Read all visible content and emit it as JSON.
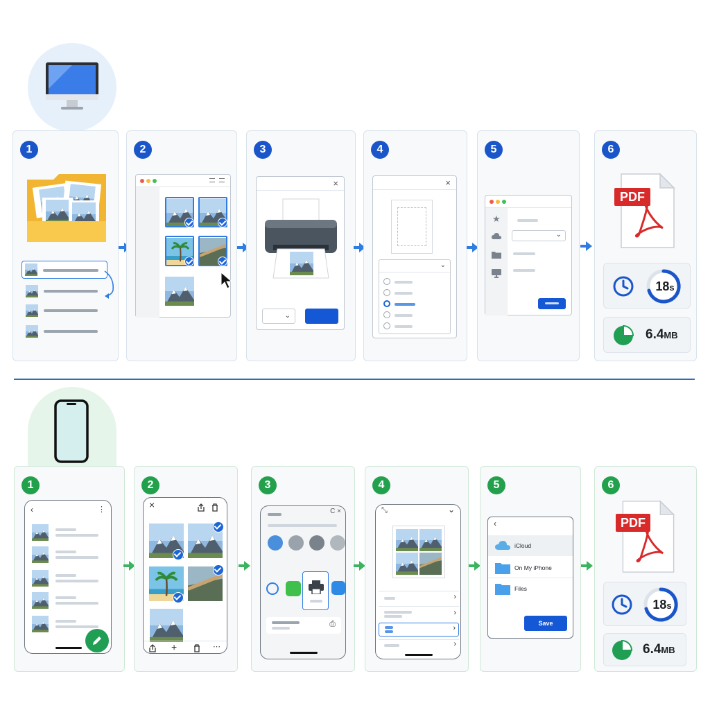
{
  "desktop_row": {
    "icon": "desktop-computer-icon",
    "steps": [
      {
        "number": "1"
      },
      {
        "number": "2"
      },
      {
        "number": "3"
      },
      {
        "number": "4"
      },
      {
        "number": "5"
      },
      {
        "number": "6",
        "pdf_label": "PDF",
        "time": "18s",
        "time_unit": "s",
        "time_value": "18",
        "size_value": "6.4",
        "size_unit": "MB"
      }
    ]
  },
  "phone_row": {
    "icon": "smartphone-icon",
    "steps": [
      {
        "number": "1"
      },
      {
        "number": "2"
      },
      {
        "number": "3"
      },
      {
        "number": "4"
      },
      {
        "number": "5",
        "locations": [
          "iCloud",
          "On My iPhone",
          "Files"
        ],
        "save_label": "Save"
      },
      {
        "number": "6",
        "pdf_label": "PDF",
        "time_value": "18",
        "time_unit": "s",
        "size_value": "6.4",
        "size_unit": "MB"
      }
    ]
  },
  "colors": {
    "desktop_accent": "#1a56c9",
    "phone_accent": "#22a04b",
    "pdf_red": "#d82a2a"
  }
}
